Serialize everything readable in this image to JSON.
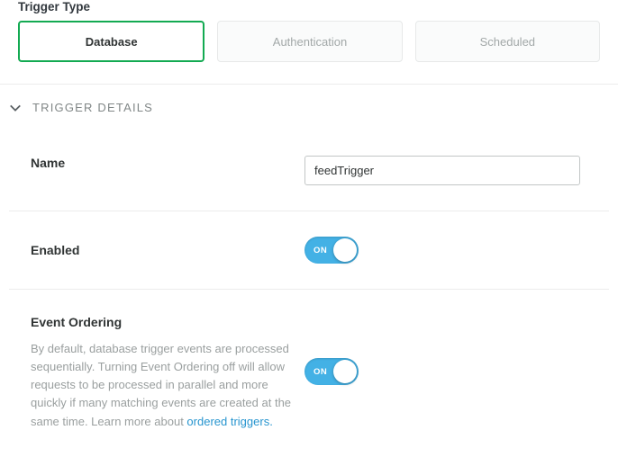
{
  "triggerType": {
    "label": "Trigger Type",
    "tabs": [
      {
        "label": "Database",
        "active": true
      },
      {
        "label": "Authentication",
        "active": false
      },
      {
        "label": "Scheduled",
        "active": false
      }
    ]
  },
  "section": {
    "title": "TRIGGER DETAILS"
  },
  "fields": {
    "name": {
      "label": "Name",
      "value": "feedTrigger"
    },
    "enabled": {
      "label": "Enabled",
      "toggle_text": "ON",
      "on": true
    },
    "eventOrdering": {
      "label": "Event Ordering",
      "help_prefix": "By default, database trigger events are processed sequentially. Turning Event Ordering off will allow requests to be processed in parallel and more quickly if many matching events are created at the same time. Learn more about ",
      "help_link": "ordered triggers.",
      "toggle_text": "ON",
      "on": true
    }
  }
}
